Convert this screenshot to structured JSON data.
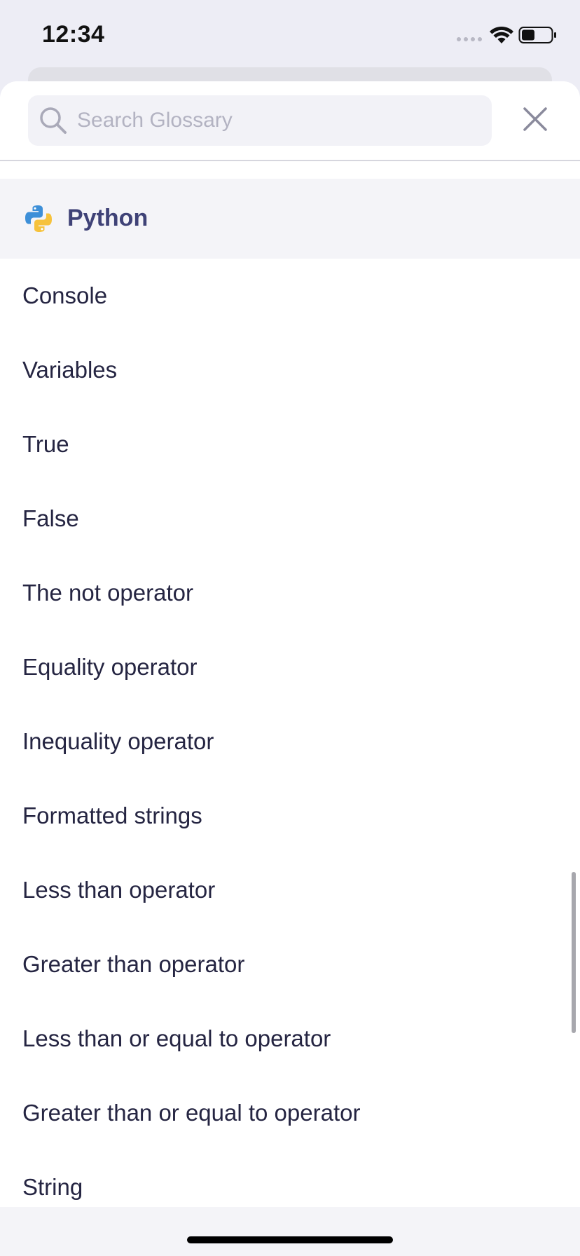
{
  "status_bar": {
    "time": "12:34"
  },
  "search": {
    "placeholder": "Search Glossary",
    "value": ""
  },
  "section": {
    "title": "Python",
    "icon": "python-logo-icon"
  },
  "terms": [
    "Console",
    "Variables",
    "True",
    "False",
    "The not operator",
    "Equality operator",
    "Inequality operator",
    "Formatted strings",
    "Less than operator",
    "Greater than operator",
    "Less than or equal to operator",
    "Greater than or equal to operator",
    "String"
  ],
  "colors": {
    "section_title": "#3f4277",
    "python_blue": "#3d8fd8",
    "python_yellow": "#f6c23c",
    "placeholder": "#b3b3c2"
  }
}
